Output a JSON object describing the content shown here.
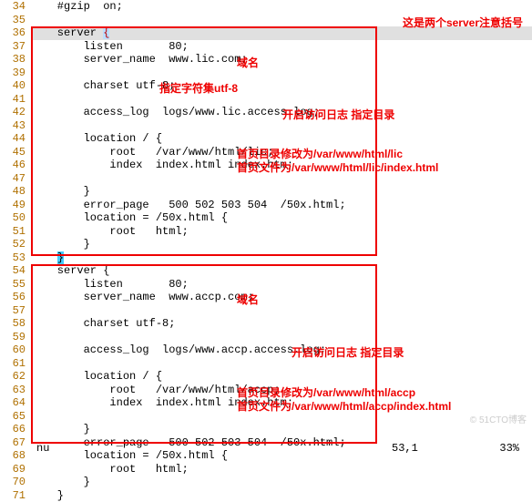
{
  "lines": [
    {
      "n": 34,
      "code": "    #gzip  on;"
    },
    {
      "n": 35,
      "code": ""
    },
    {
      "n": 36,
      "code": "    server {",
      "hl": true,
      "brace_open": true
    },
    {
      "n": 37,
      "code": "        listen       80;"
    },
    {
      "n": 38,
      "code": "        server_name  www.lic.com;"
    },
    {
      "n": 39,
      "code": ""
    },
    {
      "n": 40,
      "code": "        charset utf-8;"
    },
    {
      "n": 41,
      "code": ""
    },
    {
      "n": 42,
      "code": "        access_log  logs/www.lic.access.log;"
    },
    {
      "n": 43,
      "code": ""
    },
    {
      "n": 44,
      "code": "        location / {"
    },
    {
      "n": 45,
      "code": "            root   /var/www/html/lic;"
    },
    {
      "n": 46,
      "code": "            index  index.html index.htm;"
    },
    {
      "n": 47,
      "code": ""
    },
    {
      "n": 48,
      "code": "        }"
    },
    {
      "n": 49,
      "code": "        error_page   500 502 503 504  /50x.html;"
    },
    {
      "n": 50,
      "code": "        location = /50x.html {"
    },
    {
      "n": 51,
      "code": "            root   html;"
    },
    {
      "n": 52,
      "code": "        }"
    },
    {
      "n": 53,
      "code": "    }",
      "brace_close": true
    },
    {
      "n": 54,
      "code": "    server {"
    },
    {
      "n": 55,
      "code": "        listen       80;"
    },
    {
      "n": 56,
      "code": "        server_name  www.accp.com;"
    },
    {
      "n": 57,
      "code": ""
    },
    {
      "n": 58,
      "code": "        charset utf-8;"
    },
    {
      "n": 59,
      "code": ""
    },
    {
      "n": 60,
      "code": "        access_log  logs/www.accp.access.log;"
    },
    {
      "n": 61,
      "code": ""
    },
    {
      "n": 62,
      "code": "        location / {"
    },
    {
      "n": 63,
      "code": "            root   /var/www/html/accp;"
    },
    {
      "n": 64,
      "code": "            index  index.html index.htm;"
    },
    {
      "n": 65,
      "code": ""
    },
    {
      "n": 66,
      "code": "        }"
    },
    {
      "n": 67,
      "code": "        error_page   500 502 503 504  /50x.html;"
    },
    {
      "n": 68,
      "code": "        location = /50x.html {"
    },
    {
      "n": 69,
      "code": "            root   html;"
    },
    {
      "n": 70,
      "code": "        }"
    },
    {
      "n": 71,
      "code": "    }"
    }
  ],
  "annotations": {
    "title": "这是两个server注意括号",
    "domain1": "域名",
    "charset1": "指定字符集utf-8",
    "accesslog1": "开启访问日志  指定目录",
    "root1a": "首页目录修改为/var/www/html/lic",
    "root1b": "首页文件为/var/www/html/lic/index.html",
    "domain2": "域名",
    "accesslog2": "开启访问日志  指定目录",
    "root2a": "首页目录修改为/var/www/html/accp",
    "root2b": "首页文件为/var/www/html/accp/index.html"
  },
  "status": {
    "cmd": ":set nu",
    "pos": "53,1",
    "pct": "33%"
  },
  "watermark": "© 51CTO博客"
}
